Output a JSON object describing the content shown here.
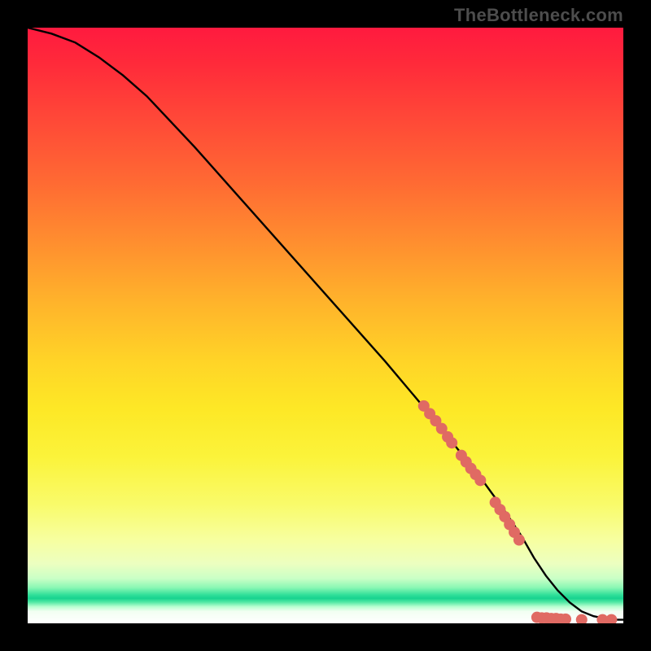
{
  "watermark": "TheBottleneck.com",
  "colors": {
    "curve": "#000000",
    "markers": "#e06a63",
    "background": "#000000"
  },
  "chart_data": {
    "type": "line",
    "title": "",
    "xlabel": "",
    "ylabel": "",
    "xlim": [
      0,
      100
    ],
    "ylim": [
      0,
      100
    ],
    "grid": false,
    "legend": false,
    "series": [
      {
        "name": "curve",
        "x": [
          0,
          4,
          8,
          12,
          16,
          20,
          28,
          36,
          44,
          52,
          60,
          68,
          76,
          80,
          83,
          85,
          87,
          89,
          91,
          93,
          95,
          97,
          99,
          100
        ],
        "y": [
          100,
          99,
          97.5,
          95,
          92,
          88.5,
          80,
          71,
          62,
          53,
          44,
          34.5,
          24.5,
          19,
          14.5,
          11,
          8,
          5.5,
          3.5,
          2,
          1.2,
          0.8,
          0.6,
          0.6
        ]
      }
    ],
    "markers": [
      {
        "x": 66.5,
        "y": 36.5
      },
      {
        "x": 67.5,
        "y": 35.2
      },
      {
        "x": 68.5,
        "y": 34.0
      },
      {
        "x": 69.5,
        "y": 32.7
      },
      {
        "x": 70.5,
        "y": 31.3
      },
      {
        "x": 71.2,
        "y": 30.3
      },
      {
        "x": 72.8,
        "y": 28.2
      },
      {
        "x": 73.6,
        "y": 27.1
      },
      {
        "x": 74.4,
        "y": 26.0
      },
      {
        "x": 75.2,
        "y": 25.0
      },
      {
        "x": 76,
        "y": 24.0
      },
      {
        "x": 78.5,
        "y": 20.3
      },
      {
        "x": 79.3,
        "y": 19.1
      },
      {
        "x": 80.1,
        "y": 17.9
      },
      {
        "x": 80.9,
        "y": 16.6
      },
      {
        "x": 81.7,
        "y": 15.3
      },
      {
        "x": 82.5,
        "y": 14.0
      },
      {
        "x": 85.5,
        "y": 1.0
      },
      {
        "x": 86.3,
        "y": 0.9
      },
      {
        "x": 87.1,
        "y": 0.9
      },
      {
        "x": 87.9,
        "y": 0.8
      },
      {
        "x": 88.7,
        "y": 0.8
      },
      {
        "x": 89.5,
        "y": 0.7
      },
      {
        "x": 90.3,
        "y": 0.7
      },
      {
        "x": 93.0,
        "y": 0.6
      },
      {
        "x": 96.5,
        "y": 0.6
      },
      {
        "x": 98.0,
        "y": 0.6
      }
    ],
    "marker_radius_px": 7
  }
}
